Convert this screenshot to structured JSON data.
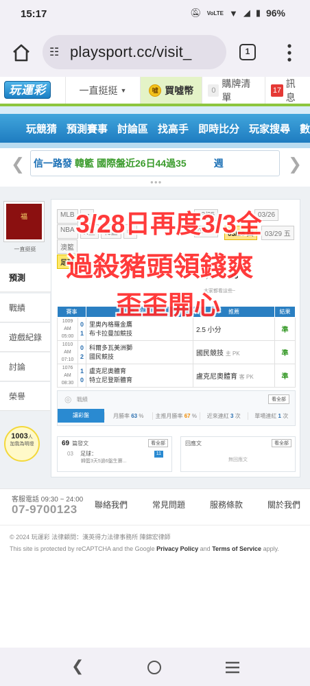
{
  "status_bar": {
    "time": "15:17",
    "icons": [
      "mute-icon",
      "volte-icon",
      "wifi-icon",
      "signal-icon",
      "battery-icon"
    ],
    "volte": "VoLTE",
    "battery": "96%"
  },
  "browser": {
    "url": "playsport.cc/visit_",
    "tab_count": "1"
  },
  "site_header": {
    "logo": "玩運彩",
    "dropdown": "一直挺挺",
    "coin_label": "買噓幣",
    "cart_count": "0",
    "cart_label": "購牌清單",
    "msg_count": "17",
    "msg_label": "訊息"
  },
  "main_menu": [
    "玩競猜",
    "預測賽事",
    "討論區",
    "找高手",
    "即時比分",
    "玩家搜尋",
    "數據"
  ],
  "ticker": {
    "part1": "信一路發",
    "part2": "韓籃",
    "part3": "國際盤近26日44過35",
    "part4": "週"
  },
  "sidebar": {
    "username": "一直挺挺",
    "items": [
      "預測",
      "戰績",
      "遊戲紀錄",
      "討論",
      "榮譽"
    ],
    "bulb_count": "1003",
    "bulb_unit": "人",
    "bulb_text": "加我為明燈"
  },
  "panel": {
    "tags_row1": [
      "MLB",
      "日"
    ],
    "tags_row2": [
      "NBA",
      "R籃",
      "韓籃",
      "中"
    ],
    "tags_row3": [
      "澳籃"
    ],
    "tag_highlight": "足球",
    "dates": [
      "03/25",
      "03/26",
      "03/27",
      "03/28 四",
      "03/29 五"
    ],
    "today_label": "今日人氣",
    "today_count": "25",
    "watermark": "大家都看這些~",
    "table_headers": [
      "賽事",
      "隊伍",
      "推薦",
      "結果"
    ],
    "games": [
      {
        "no": "1009",
        "time": "AM 05:00",
        "s1": "0",
        "s2": "1",
        "t1": "里奧內格羅金鷹",
        "t2": "布卡拉曼加競技",
        "pick": "2.5 小分",
        "pick_note": "",
        "result": "準"
      },
      {
        "no": "1010",
        "time": "AM 07:10",
        "s1": "0",
        "s2": "2",
        "t1": "科爾多瓦美洲獅",
        "t2": "國民競技",
        "pick": "國民競技",
        "pick_note": "主 PK",
        "result": "準"
      },
      {
        "no": "1076",
        "time": "AM 08:30",
        "s1": "1",
        "s2": "0",
        "t1": "盧克尼奧體育",
        "t2": "特立尼登斯體育",
        "pick": "盧克尼奧體育",
        "pick_note": "客 PK",
        "result": "準"
      }
    ],
    "record": {
      "title": "戰績",
      "more": "看全部",
      "season": "讓彩盤",
      "win_rate_label": "月勝率",
      "win_rate": "63",
      "main_rate_label": "主推月勝率",
      "main_rate": "67",
      "streak_label": "近來連紅",
      "streak": "3",
      "streak_unit": "次",
      "loss_label": "單場連紅",
      "loss": "1",
      "loss_unit": "次"
    },
    "article_box": {
      "count": "69",
      "label": "篇發文",
      "more": "看全部",
      "date": "03",
      "item_title": "足球：",
      "item_text": "韓籃3天5過6盤生賽...",
      "badge": "11"
    },
    "reply_box": {
      "label": "回應文",
      "more": "看全部",
      "empty": "無回應文"
    }
  },
  "overlay": {
    "line1": "3/28日再度3/3全",
    "line2": "過殺豬頭領錢爽",
    "line3": "歪歪開心"
  },
  "footer": {
    "phone_label": "客服電話 09:30 ~ 24:00",
    "phone": "07-9700123",
    "links": [
      "聯絡我們",
      "常見問題",
      "服務條款",
      "關於我們"
    ],
    "copyright": "© 2024 玩運彩 法律顧問：漢英得力法律事務所 陳錦宏律師",
    "captcha_a": "This site is protected by reCAPTCHA and the Google ",
    "privacy": "Privacy Policy",
    "and": " and ",
    "terms": "Terms of Service",
    "apply": " apply."
  },
  "colors": {
    "brand_blue": "#1e7cc0",
    "brand_green": "#8dc63f",
    "overlay_red": "#ff2b2b"
  }
}
